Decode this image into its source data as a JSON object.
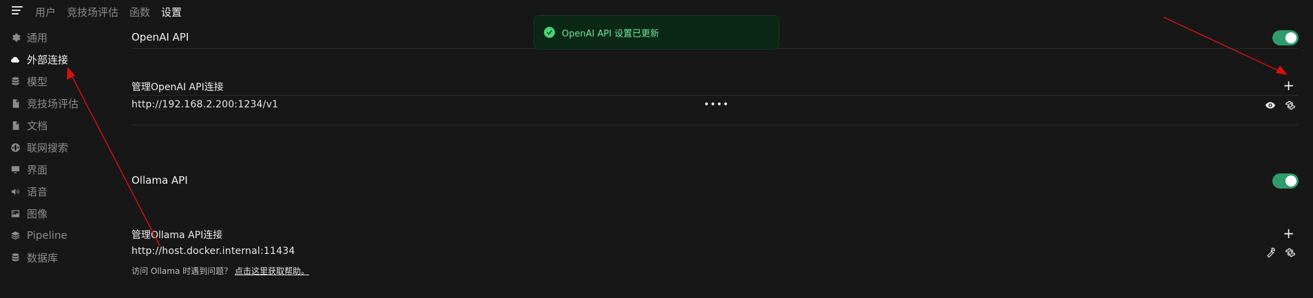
{
  "topnav": {
    "tabs": [
      {
        "label": "用户"
      },
      {
        "label": "竞技场评估"
      },
      {
        "label": "函数"
      },
      {
        "label": "设置"
      }
    ]
  },
  "sidebar": {
    "items": [
      {
        "label": "通用",
        "icon": "gear-icon"
      },
      {
        "label": "外部连接",
        "icon": "cloud-icon"
      },
      {
        "label": "模型",
        "icon": "database-icon"
      },
      {
        "label": "竞技场评估",
        "icon": "document-icon"
      },
      {
        "label": "文档",
        "icon": "document-icon"
      },
      {
        "label": "联网搜索",
        "icon": "globe-icon"
      },
      {
        "label": "界面",
        "icon": "monitor-icon"
      },
      {
        "label": "语音",
        "icon": "speaker-icon"
      },
      {
        "label": "图像",
        "icon": "image-icon"
      },
      {
        "label": "Pipeline",
        "icon": "layers-icon"
      },
      {
        "label": "数据库",
        "icon": "database-icon"
      }
    ]
  },
  "openai": {
    "title": "OpenAI API",
    "manage_label": "管理OpenAI API连接",
    "url": "http://192.168.2.200:1234/v1",
    "key_masked": "••••",
    "enabled": true
  },
  "ollama": {
    "title": "Ollama API",
    "manage_label": "管理Ollama API连接",
    "url": "http://host.docker.internal:11434",
    "help_text": "访问 Ollama 时遇到问题？",
    "help_link": "点击这里获取帮助。",
    "enabled": true
  },
  "toast": {
    "message": "OpenAI API 设置已更新"
  },
  "colors": {
    "background": "#171717",
    "toggle_on": "#2e9d6b",
    "toast_bg": "#0b2716",
    "toast_text": "#6ee69a",
    "annotation_arrow": "#d41010"
  }
}
